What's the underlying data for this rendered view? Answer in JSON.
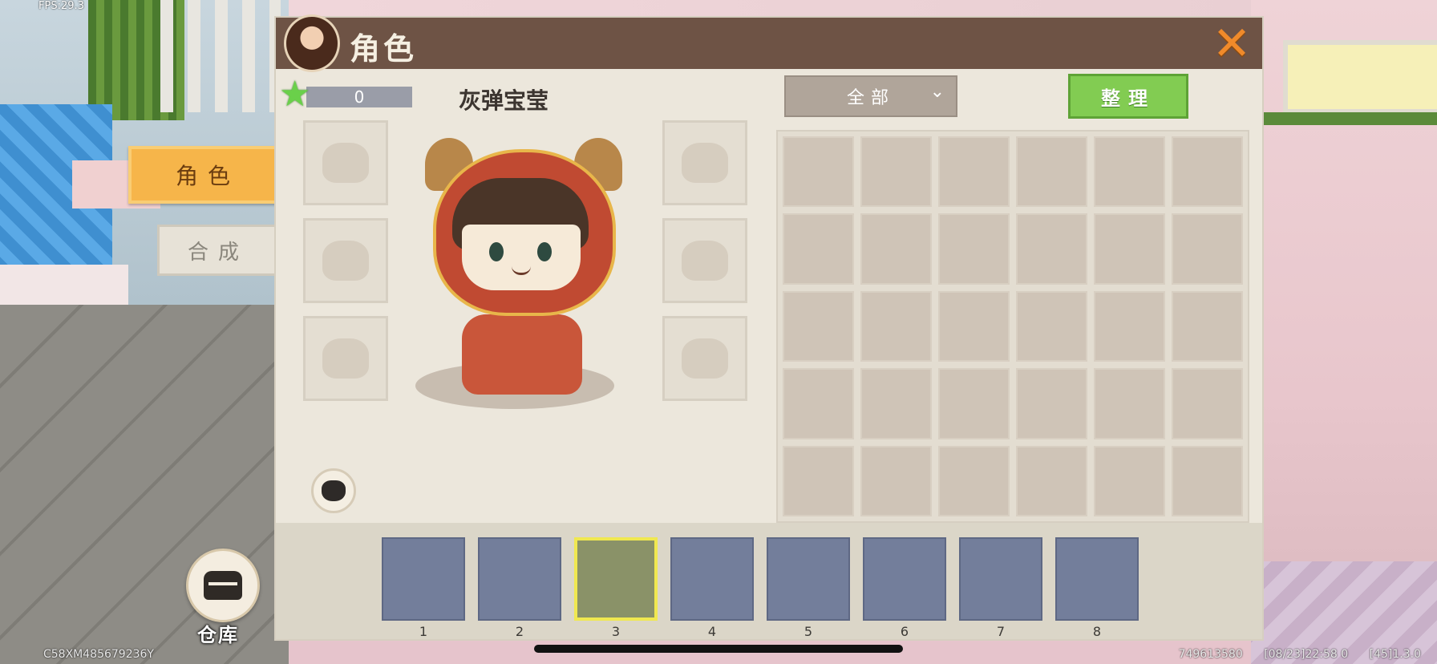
{
  "hud": {
    "fps": "FPS:29.3",
    "device_id": "C58XM485679236Y",
    "uid": "749613580",
    "timestamp": "[08/23]22:58 0",
    "version": "[45]1.3.0"
  },
  "warehouse": {
    "label": "仓库",
    "icon": "chest-icon"
  },
  "side_tabs": [
    {
      "label": "角色",
      "active": true
    },
    {
      "label": "合成",
      "active": false
    }
  ],
  "panel": {
    "title": "角色",
    "close_icon": "close-icon",
    "star_count": "0",
    "character_name": "灰弹宝莹",
    "filter": {
      "selected": "全部"
    },
    "sort_label": "整理"
  },
  "equipment_slots": {
    "left": [
      "helmet-slot",
      "chest-armor-slot",
      "leg-armor-slot"
    ],
    "right": [
      "boots-slot",
      "accessory-slot",
      "wings-slot"
    ]
  },
  "inventory": {
    "rows": 5,
    "columns": 6
  },
  "hotbar": {
    "slots": [
      "1",
      "2",
      "3",
      "4",
      "5",
      "6",
      "7",
      "8"
    ],
    "selected_index": 2
  },
  "colors": {
    "header": "#6e5345",
    "active_tab": "#f6b54a",
    "sort_button": "#82cc52",
    "close": "#f08a2a",
    "hotbar_slot": "#737e9b",
    "hotbar_selected_border": "#f0e850"
  }
}
